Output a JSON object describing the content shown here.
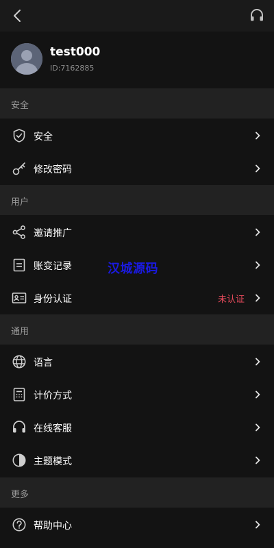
{
  "profile": {
    "username": "test000",
    "user_id": "ID:7162885"
  },
  "sections": {
    "security": "安全",
    "user": "用户",
    "general": "通用",
    "more": "更多"
  },
  "items": {
    "security": "安全",
    "change_password": "修改密码",
    "invite": "邀请推广",
    "account_log": "账变记录",
    "identity": "身份认证",
    "identity_status": "未认证",
    "language": "语言",
    "pricing": "计价方式",
    "support": "在线客服",
    "theme": "主题模式",
    "help": "帮助中心"
  },
  "watermark": "汉城源码",
  "colors": {
    "background": "#131313",
    "section_header": "#222222",
    "status_red": "#e84b5c",
    "watermark_blue": "#1a1ae0"
  },
  "icons": {
    "back": "chevron-left-icon",
    "headset": "headset-icon",
    "shield": "shield-check-icon",
    "key": "key-icon",
    "share": "share-icon",
    "document": "document-icon",
    "id_card": "id-card-icon",
    "globe": "globe-icon",
    "calculator": "calculator-icon",
    "theme": "half-circle-icon",
    "help": "question-circle-icon"
  }
}
